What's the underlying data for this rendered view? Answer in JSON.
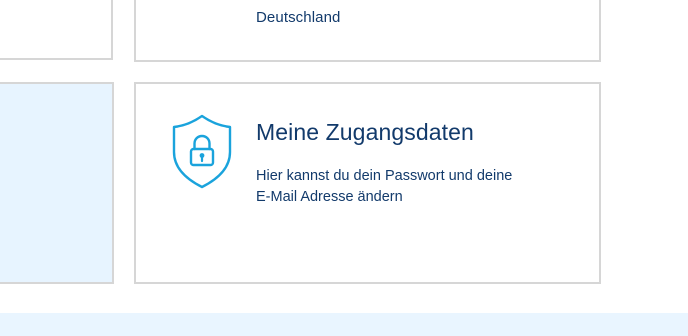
{
  "cards": {
    "address_card": {
      "country": "Deutschland"
    },
    "credentials_card": {
      "title": "Meine Zugangsdaten",
      "description_line1": "Hier kannst du dein Passwort und deine",
      "description_line2": "E-Mail Adresse ändern",
      "icon": "shield-lock-icon"
    }
  },
  "colors": {
    "text": "#123a6b",
    "icon": "#1aa3dc",
    "border": "#d6d6d6",
    "highlight_bg": "#e7f4ff"
  }
}
